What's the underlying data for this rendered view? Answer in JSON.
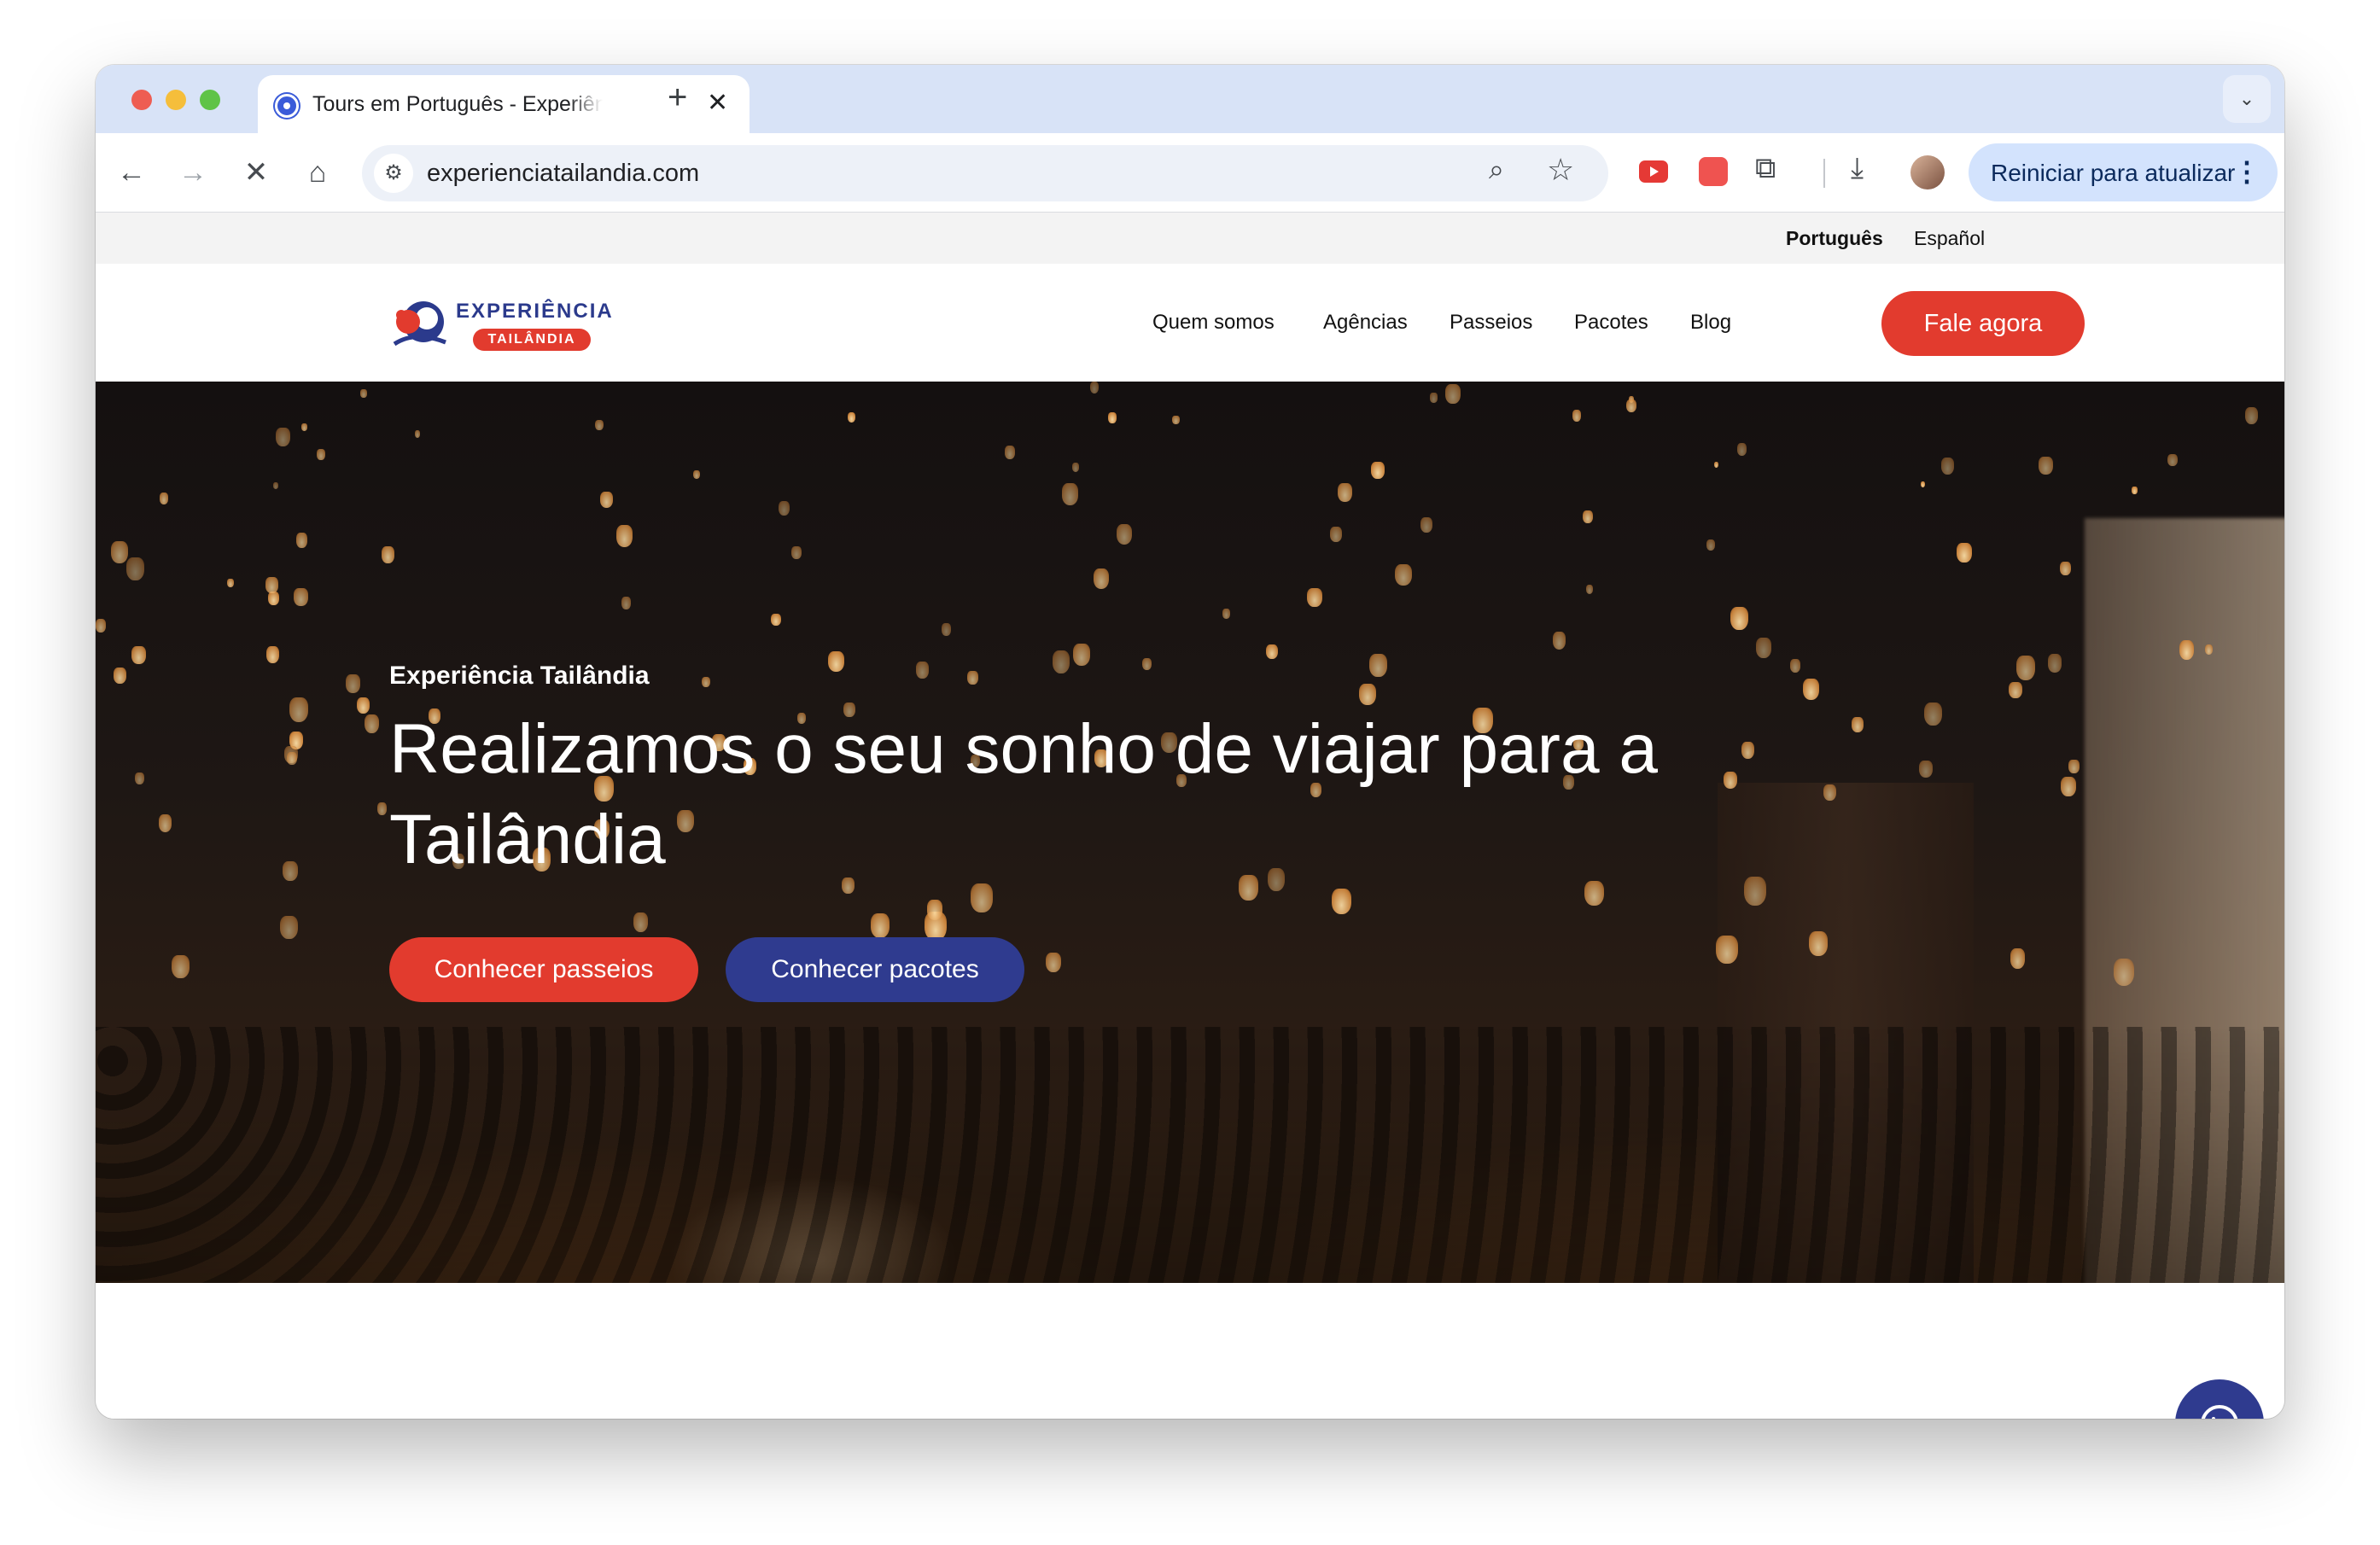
{
  "browser": {
    "tab_title": "Tours em Português - Experiência Tailândia",
    "url": "experienciatailandia.com",
    "restart_label": "Reiniciar para atualizar"
  },
  "site": {
    "languages": {
      "active": "Português",
      "other": "Español"
    },
    "logo": {
      "top": "EXPERIÊNCIA",
      "bottom": "TAILÂNDIA"
    },
    "nav": [
      "Quem somos",
      "Agências",
      "Passeios",
      "Pacotes",
      "Blog"
    ],
    "cta": "Fale agora",
    "hero": {
      "kicker": "Experiência Tailândia",
      "title": "Realizamos o seu sonho de viajar para a Tailândia",
      "btn_primary": "Conhecer passeios",
      "btn_secondary": "Conhecer pacotes"
    }
  },
  "colors": {
    "brand_red": "#e23b2e",
    "brand_blue": "#2f3b8f"
  },
  "icons": [
    "back-icon",
    "forward-icon",
    "stop-icon",
    "home-icon",
    "tune-icon",
    "zoom-icon",
    "star-icon",
    "puzzle-icon",
    "download-icon",
    "more-vert-icon",
    "whatsapp-icon"
  ]
}
